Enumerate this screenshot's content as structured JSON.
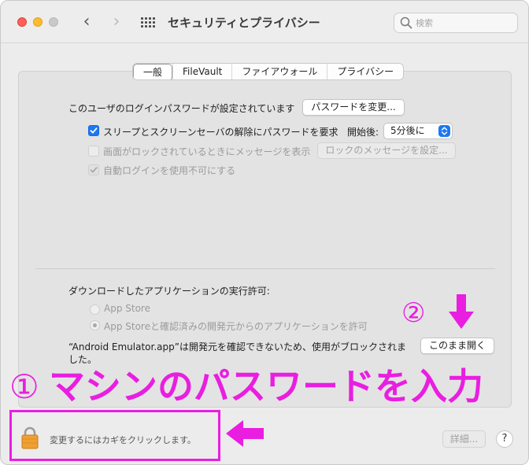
{
  "window": {
    "title": "セキュリティとプライバシー",
    "search_placeholder": "検索"
  },
  "tabs": [
    {
      "label": "一般",
      "active": true
    },
    {
      "label": "FileVault",
      "active": false
    },
    {
      "label": "ファイアウォール",
      "active": false
    },
    {
      "label": "プライバシー",
      "active": false
    }
  ],
  "general": {
    "password_set_text": "このユーザのログインパスワードが設定されています",
    "change_password_button": "パスワードを変更...",
    "require_password_label": "スリープとスクリーンセーバの解除にパスワードを要求",
    "require_password_checked": true,
    "start_after_label": "開始後:",
    "start_after_value": "5分後に",
    "lock_message_label": "画面がロックされているときにメッセージを表示",
    "lock_message_checked": false,
    "lock_message_button": "ロックのメッセージを設定...",
    "disable_autologin_label": "自動ログインを使用不可にする",
    "disable_autologin_checked": true
  },
  "downloads": {
    "heading": "ダウンロードしたアプリケーションの実行許可:",
    "option_app_store": "App Store",
    "option_identified": "App Storeと確認済みの開発元からのアプリケーションを許可",
    "selected": "option_identified",
    "blocked_message_line1": "“Android Emulator.app”は開発元を確認できないため、使用がブロックされま",
    "blocked_message_line2": "した。",
    "open_anyway_button": "このまま開く"
  },
  "footer": {
    "lock_text": "変更するにはカギをクリックします。",
    "advanced_button": "詳細...",
    "help_button": "?"
  },
  "annotations": {
    "step1_marker": "①",
    "step1_text": "マシンのパスワードを入力",
    "step2_marker": "②",
    "color": "#e91ee1"
  },
  "colors": {
    "accent": "#1d77f2",
    "annotation": "#e91ee1"
  }
}
